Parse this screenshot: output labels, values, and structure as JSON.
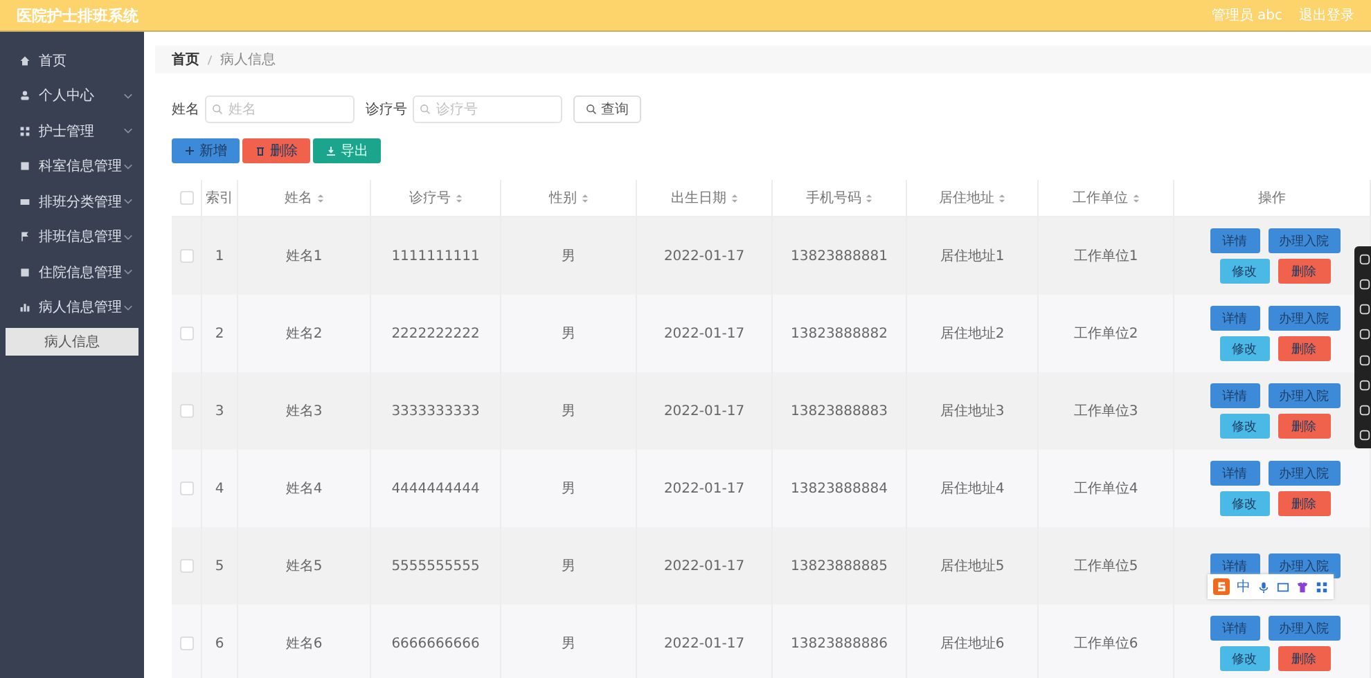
{
  "header": {
    "title": "医院护士排班系统",
    "user": "管理员 abc",
    "logout": "退出登录"
  },
  "sidebar": {
    "items": [
      {
        "label": "首页",
        "kind": "link",
        "selected": false
      },
      {
        "label": "个人中心",
        "kind": "menu",
        "selected": false
      },
      {
        "label": "护士管理",
        "kind": "menu",
        "selected": false
      },
      {
        "label": "科室信息管理",
        "kind": "menu",
        "selected": false
      },
      {
        "label": "排班分类管理",
        "kind": "menu",
        "selected": false
      },
      {
        "label": "排班信息管理",
        "kind": "menu",
        "selected": false
      },
      {
        "label": "住院信息管理",
        "kind": "menu",
        "selected": false
      },
      {
        "label": "病人信息管理",
        "kind": "menu",
        "selected": false,
        "children": [
          {
            "label": "病人信息",
            "selected": true
          }
        ]
      }
    ]
  },
  "breadcrumb": [
    "首页",
    "病人信息"
  ],
  "search": {
    "fields": [
      {
        "label": "姓名",
        "placeholder": "姓名"
      },
      {
        "label": "诊疗号",
        "placeholder": "诊疗号"
      }
    ],
    "button": "查询"
  },
  "actions": [
    {
      "label": "新增",
      "kind": "add"
    },
    {
      "label": "删除",
      "kind": "delete"
    },
    {
      "label": "导出",
      "kind": "export"
    }
  ],
  "table": {
    "all_checked": false,
    "columns": [
      {
        "label": "索引",
        "kind": "plain"
      },
      {
        "label": "姓名",
        "kind": "sortable"
      },
      {
        "label": "诊疗号",
        "kind": "sortable"
      },
      {
        "label": "性别",
        "kind": "sortable"
      },
      {
        "label": "出生日期",
        "kind": "sortable"
      },
      {
        "label": "手机号码",
        "kind": "sortable"
      },
      {
        "label": "居住地址",
        "kind": "sortable"
      },
      {
        "label": "工作单位",
        "kind": "sortable"
      },
      {
        "label": "操作",
        "kind": "plain"
      }
    ],
    "rows": [
      {
        "checked": false,
        "cells": [
          "1",
          "姓名1",
          "1111111111",
          "男",
          "2022-01-17",
          "13823888881",
          "居住地址1",
          "工作单位1"
        ],
        "buttons": [
          {
            "label": "详情",
            "kind": "detail"
          },
          {
            "label": "办理入院",
            "kind": "admit"
          },
          {
            "label": "修改",
            "kind": "edit"
          },
          {
            "label": "删除",
            "kind": "delete"
          }
        ]
      },
      {
        "checked": false,
        "cells": [
          "2",
          "姓名2",
          "2222222222",
          "男",
          "2022-01-17",
          "13823888882",
          "居住地址2",
          "工作单位2"
        ],
        "buttons": [
          {
            "label": "详情",
            "kind": "detail"
          },
          {
            "label": "办理入院",
            "kind": "admit"
          },
          {
            "label": "修改",
            "kind": "edit"
          },
          {
            "label": "删除",
            "kind": "delete"
          }
        ]
      },
      {
        "checked": false,
        "cells": [
          "3",
          "姓名3",
          "3333333333",
          "男",
          "2022-01-17",
          "13823888883",
          "居住地址3",
          "工作单位3"
        ],
        "buttons": [
          {
            "label": "详情",
            "kind": "detail"
          },
          {
            "label": "办理入院",
            "kind": "admit"
          },
          {
            "label": "修改",
            "kind": "edit"
          },
          {
            "label": "删除",
            "kind": "delete"
          }
        ]
      },
      {
        "checked": false,
        "cells": [
          "4",
          "姓名4",
          "4444444444",
          "男",
          "2022-01-17",
          "13823888884",
          "居住地址4",
          "工作单位4"
        ],
        "buttons": [
          {
            "label": "详情",
            "kind": "detail"
          },
          {
            "label": "办理入院",
            "kind": "admit"
          },
          {
            "label": "修改",
            "kind": "edit"
          },
          {
            "label": "删除",
            "kind": "delete"
          }
        ]
      },
      {
        "checked": false,
        "cells": [
          "5",
          "姓名5",
          "5555555555",
          "男",
          "2022-01-17",
          "13823888885",
          "居住地址5",
          "工作单位5"
        ],
        "buttons": [
          {
            "label": "详情",
            "kind": "detail"
          },
          {
            "label": "办理入院",
            "kind": "admit"
          }
        ]
      },
      {
        "checked": false,
        "cells": [
          "6",
          "姓名6",
          "6666666666",
          "男",
          "2022-01-17",
          "13823888886",
          "居住地址6",
          "工作单位6"
        ],
        "buttons": [
          {
            "label": "详情",
            "kind": "detail"
          },
          {
            "label": "办理入院",
            "kind": "admit"
          },
          {
            "label": "修改",
            "kind": "edit"
          },
          {
            "label": "删除",
            "kind": "delete"
          }
        ]
      }
    ]
  },
  "ime_bar": {
    "mode": "中"
  }
}
